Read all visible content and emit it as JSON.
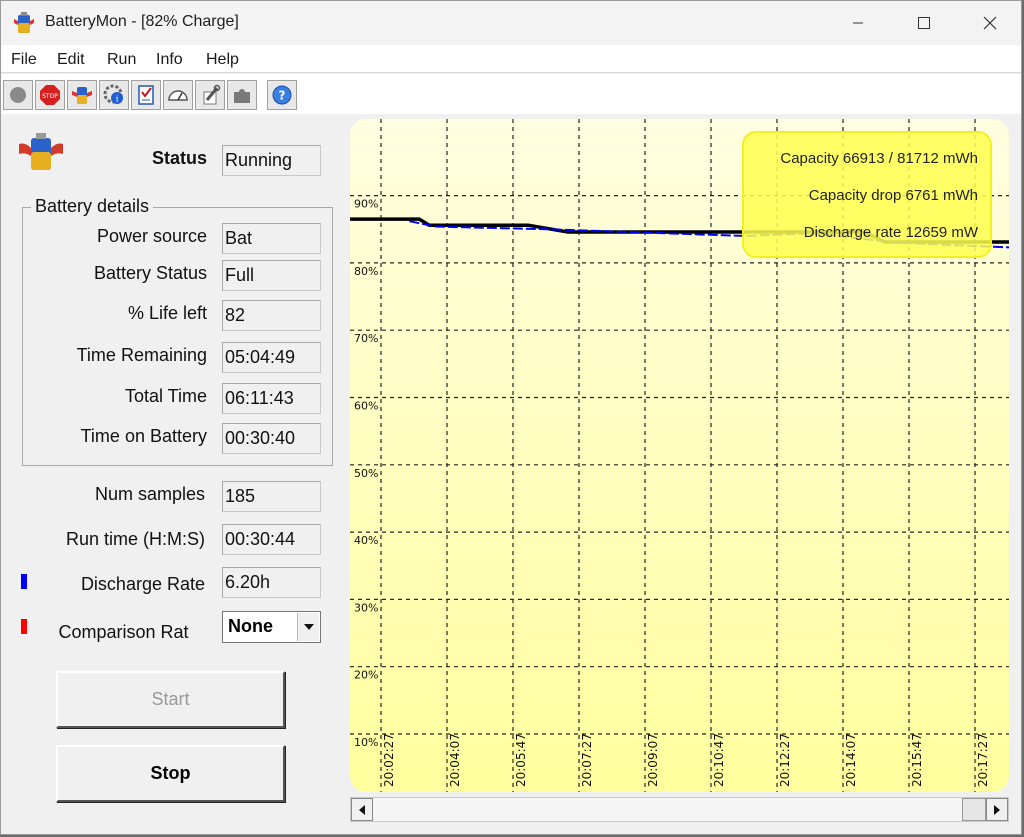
{
  "window": {
    "title": "BatteryMon - [82% Charge]"
  },
  "menu": [
    "File",
    "Edit",
    "Run",
    "Info",
    "Help"
  ],
  "toolbar": [
    {
      "name": "record-icon"
    },
    {
      "name": "stop-icon"
    },
    {
      "name": "battery-icon"
    },
    {
      "name": "info-gear-icon"
    },
    {
      "name": "checklist-icon"
    },
    {
      "name": "gauge-icon"
    },
    {
      "name": "wrench-icon"
    },
    {
      "name": "puzzle-icon"
    },
    {
      "name": "help-icon"
    }
  ],
  "status": {
    "label": "Status",
    "value": "Running"
  },
  "details": {
    "title": "Battery details",
    "rows": [
      {
        "label": "Power source",
        "value": "Bat"
      },
      {
        "label": "Battery Status",
        "value": "Full"
      },
      {
        "label": "% Life left",
        "value": "82"
      },
      {
        "label": "Time Remaining",
        "value": "05:04:49"
      },
      {
        "label": "Total Time",
        "value": "06:11:43"
      },
      {
        "label": "Time on Battery",
        "value": "00:30:40"
      }
    ]
  },
  "stats": {
    "num_samples": {
      "label": "Num samples",
      "value": "185"
    },
    "run_time": {
      "label": "Run time (H:M:S)",
      "value": "00:30:44"
    },
    "discharge": {
      "label": "Discharge Rate",
      "value": "6.20h",
      "color": "#0000ff"
    },
    "comparison": {
      "label": "Comparison Rat",
      "value": "None",
      "color": "#ff0000"
    }
  },
  "buttons": {
    "start": "Start",
    "stop": "Stop"
  },
  "chart_data": {
    "type": "line",
    "ylim": [
      10,
      95
    ],
    "y_ticks": [
      "10%",
      "20%",
      "30%",
      "40%",
      "50%",
      "60%",
      "70%",
      "80%",
      "90%"
    ],
    "x_ticks": [
      "20:02:27",
      "20:04:07",
      "20:05:47",
      "20:07:27",
      "20:09:07",
      "20:10:47",
      "20:12:27",
      "20:14:07",
      "20:15:47",
      "20:17:27"
    ],
    "grid": true,
    "series": [
      {
        "color": "#000000",
        "points": [
          [
            0,
            86.5
          ],
          [
            1.05,
            86.5
          ],
          [
            1.2,
            85.6
          ],
          [
            2.7,
            85.6
          ],
          [
            3.3,
            84.6
          ],
          [
            7.8,
            84.6
          ],
          [
            8.1,
            83.1
          ],
          [
            10.25,
            83.1
          ]
        ]
      },
      {
        "color": "#0000ff",
        "points": [
          [
            0.9,
            86.2
          ],
          [
            1.3,
            85.4
          ],
          [
            3.0,
            85.0
          ],
          [
            6.0,
            84.0
          ],
          [
            7.0,
            84.4
          ],
          [
            8.3,
            83.0
          ],
          [
            10.25,
            82.2
          ]
        ]
      }
    ],
    "info_box": [
      "Capacity 66913 / 81712 mWh",
      "Capacity drop 6761 mWh",
      "Discharge rate 12659 mW"
    ]
  }
}
